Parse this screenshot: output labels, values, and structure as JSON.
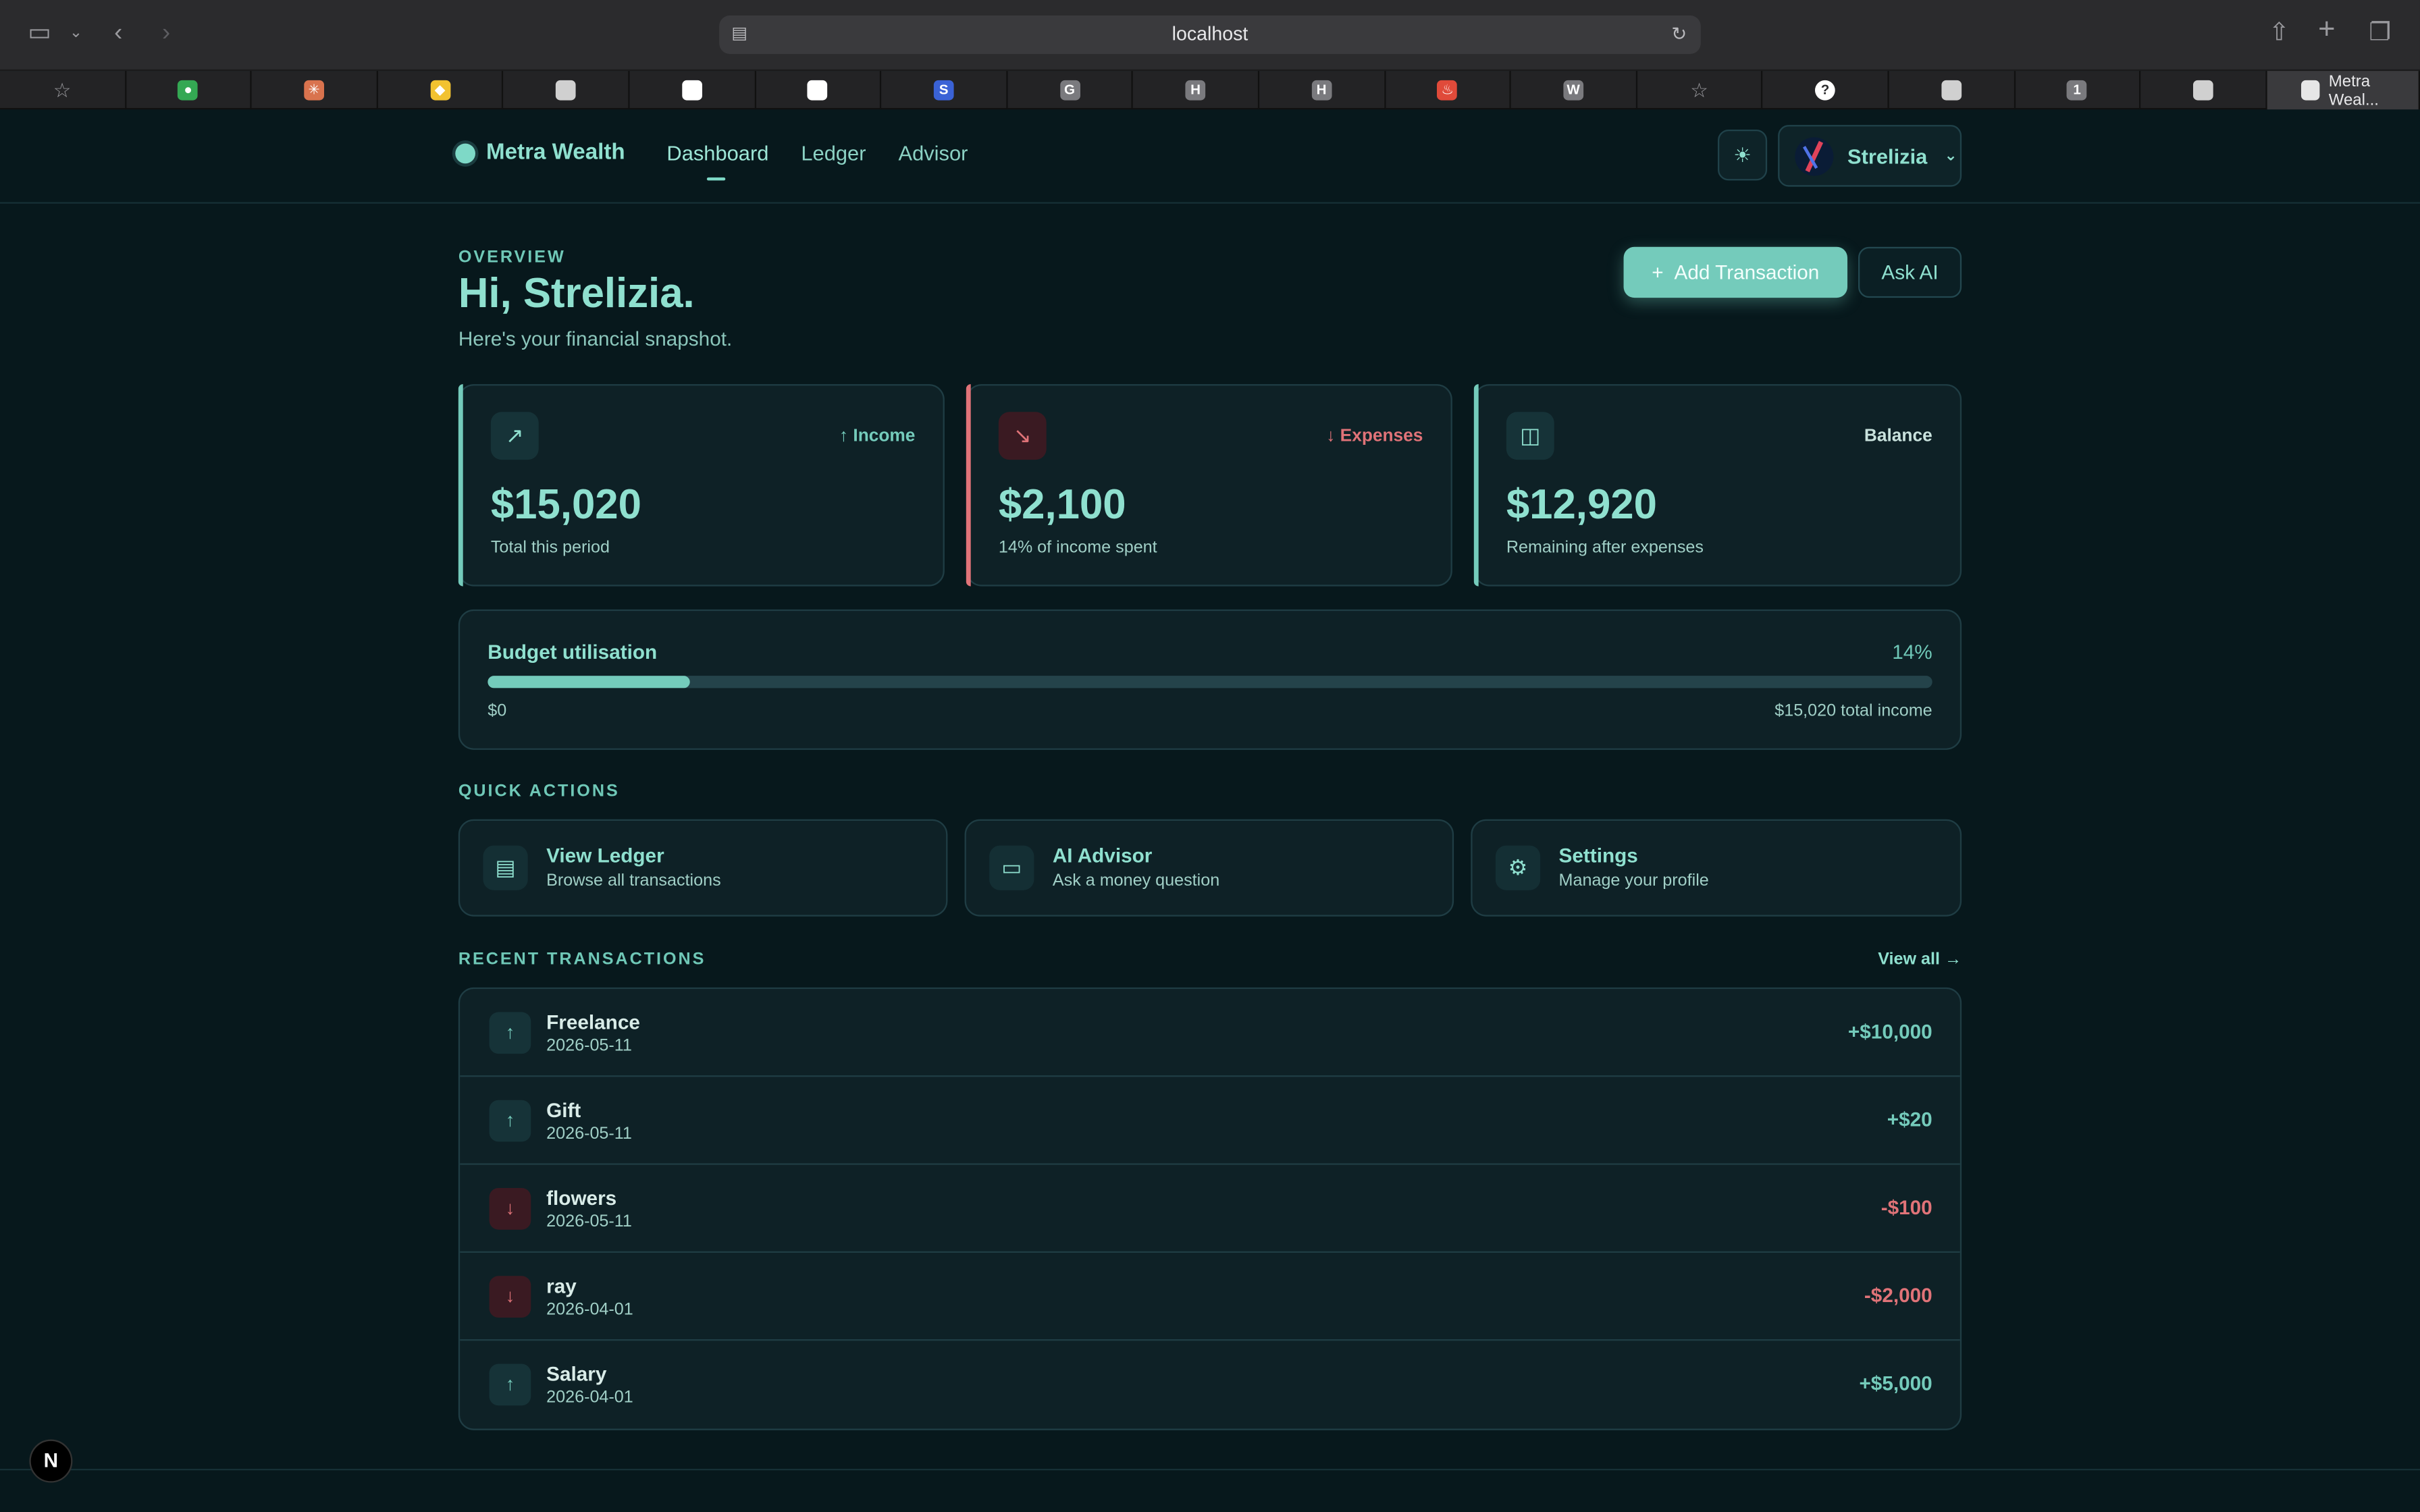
{
  "browser": {
    "url": "localhost",
    "active_tab_title": "Metra Weal...",
    "tabs": [
      {
        "icon": "star-icon",
        "color": "#9a9a9e",
        "glyph": "☆"
      },
      {
        "icon": "maps-icon",
        "color": "#34a853",
        "glyph": "●"
      },
      {
        "icon": "asterisk-icon",
        "color": "#d9734e",
        "glyph": "✳"
      },
      {
        "icon": "badge-icon",
        "color": "#f2c230",
        "glyph": "◆"
      },
      {
        "icon": "blank-icon",
        "color": "#d0d0d0",
        "glyph": ""
      },
      {
        "icon": "github-icon",
        "color": "#ffffff",
        "glyph": "●"
      },
      {
        "icon": "github-icon",
        "color": "#ffffff",
        "glyph": "●"
      },
      {
        "icon": "s-icon",
        "color": "#3a62d6",
        "glyph": "S"
      },
      {
        "icon": "g-icon",
        "color": "#7a7a7e",
        "glyph": "G"
      },
      {
        "icon": "h-icon",
        "color": "#7a7a7e",
        "glyph": "H"
      },
      {
        "icon": "h-icon",
        "color": "#7a7a7e",
        "glyph": "H"
      },
      {
        "icon": "flame-icon",
        "color": "#e04a3a",
        "glyph": "♨"
      },
      {
        "icon": "w-icon",
        "color": "#7a7a7e",
        "glyph": "W"
      },
      {
        "icon": "star-icon",
        "color": "#9a9a9e",
        "glyph": "☆"
      },
      {
        "icon": "question-icon",
        "color": "#2b2b2d",
        "glyph": "?"
      },
      {
        "icon": "blank-icon",
        "color": "#d0d0d0",
        "glyph": ""
      },
      {
        "icon": "one-icon",
        "color": "#7a7a7e",
        "glyph": "1"
      },
      {
        "icon": "blank-icon",
        "color": "#d0d0d0",
        "glyph": ""
      }
    ]
  },
  "nav": {
    "brand": "Metra Wealth",
    "links": [
      "Dashboard",
      "Ledger",
      "Advisor"
    ],
    "user": "Strelizia"
  },
  "hero": {
    "eyebrow": "OVERVIEW",
    "title": "Hi, Strelizia.",
    "subtitle": "Here's your financial snapshot.",
    "add_button": "Add Transaction",
    "ask_button": "Ask AI"
  },
  "cards": [
    {
      "tag": "Income",
      "value": "$15,020",
      "label": "Total this period",
      "accent": "#74cbbb",
      "tag_color": "#74cbbb"
    },
    {
      "tag": "Expenses",
      "value": "$2,100",
      "label": "14% of income spent",
      "accent": "#e07378",
      "tag_color": "#e07378"
    },
    {
      "tag": "Balance",
      "value": "$12,920",
      "label": "Remaining after expenses",
      "accent": "#74cbbb",
      "tag_color": "#c9e2dd"
    }
  ],
  "budget": {
    "title": "Budget utilisation",
    "percent": "14%",
    "fill_fraction": 0.14,
    "min_label": "$0",
    "max_label": "$15,020 total income"
  },
  "quick_actions": {
    "title": "QUICK ACTIONS",
    "items": [
      {
        "title": "View Ledger",
        "subtitle": "Browse all transactions",
        "icon": "document-icon"
      },
      {
        "title": "AI Advisor",
        "subtitle": "Ask a money question",
        "icon": "chat-icon"
      },
      {
        "title": "Settings",
        "subtitle": "Manage your profile",
        "icon": "gear-icon"
      }
    ]
  },
  "recent": {
    "title": "RECENT TRANSACTIONS",
    "view_all": "View all →",
    "items": [
      {
        "name": "Freelance",
        "date": "2026-05-11",
        "amount": "+$10,000",
        "type": "income"
      },
      {
        "name": "Gift",
        "date": "2026-05-11",
        "amount": "+$20",
        "type": "income"
      },
      {
        "name": "flowers",
        "date": "2026-05-11",
        "amount": "-$100",
        "type": "expense"
      },
      {
        "name": "ray",
        "date": "2026-04-01",
        "amount": "-$2,000",
        "type": "expense"
      },
      {
        "name": "Salary",
        "date": "2026-04-01",
        "amount": "+$5,000",
        "type": "income"
      }
    ]
  },
  "colors": {
    "income": "#74cbbb",
    "expense": "#e07378",
    "income_bg": "#163338",
    "expense_bg": "#3a1a22"
  },
  "dev_badge": "N"
}
